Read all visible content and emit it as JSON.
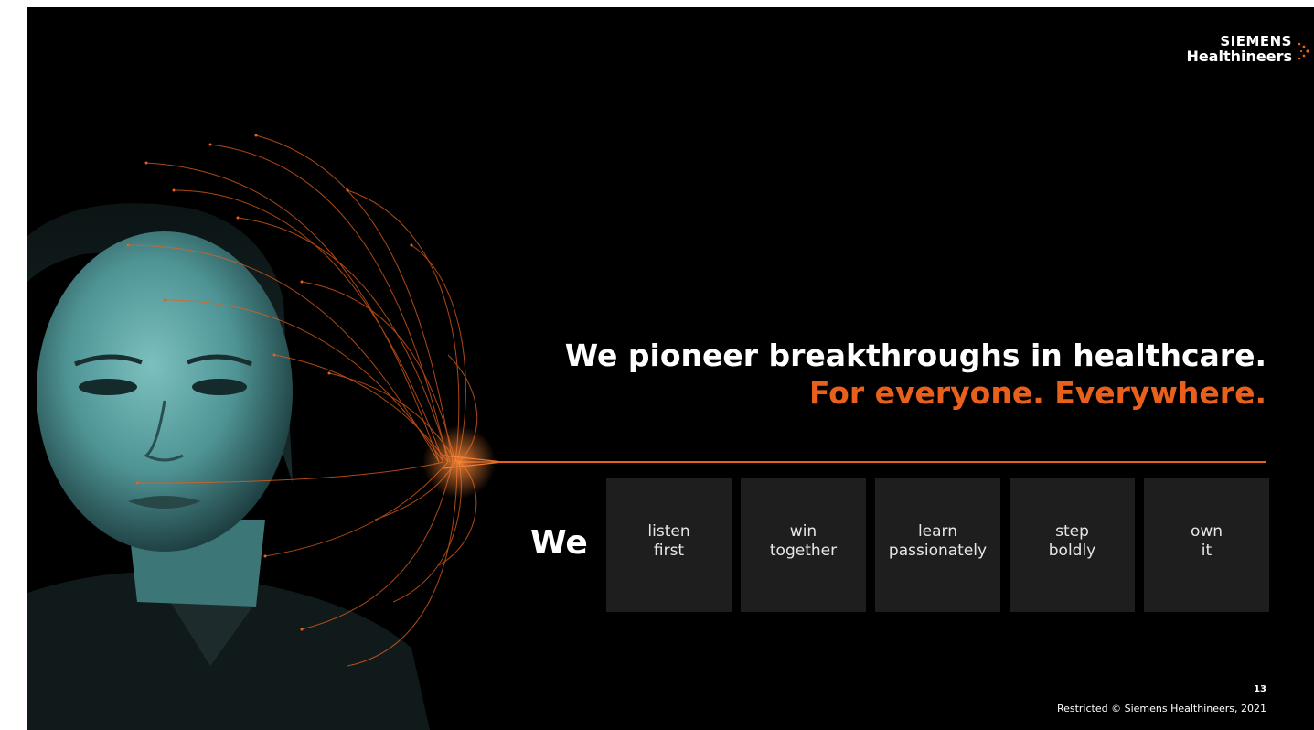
{
  "logo": {
    "line1": "SIEMENS",
    "line2": "Healthineers"
  },
  "headline": {
    "line1": "We pioneer breakthroughs in healthcare.",
    "line2": "For everyone. Everywhere."
  },
  "values": {
    "lead": "We",
    "items": [
      {
        "top": "listen",
        "bottom": "first"
      },
      {
        "top": "win",
        "bottom": "together"
      },
      {
        "top": "learn",
        "bottom": "passionately"
      },
      {
        "top": "step",
        "bottom": "boldly"
      },
      {
        "top": "own",
        "bottom": "it"
      }
    ]
  },
  "footer": {
    "page_number": "13",
    "text": "Restricted © Siemens Healthineers, 2021"
  },
  "colors": {
    "background": "#000000",
    "accent": "#e8601c",
    "box": "#1e1e1e",
    "face": "#5fa7a7"
  }
}
